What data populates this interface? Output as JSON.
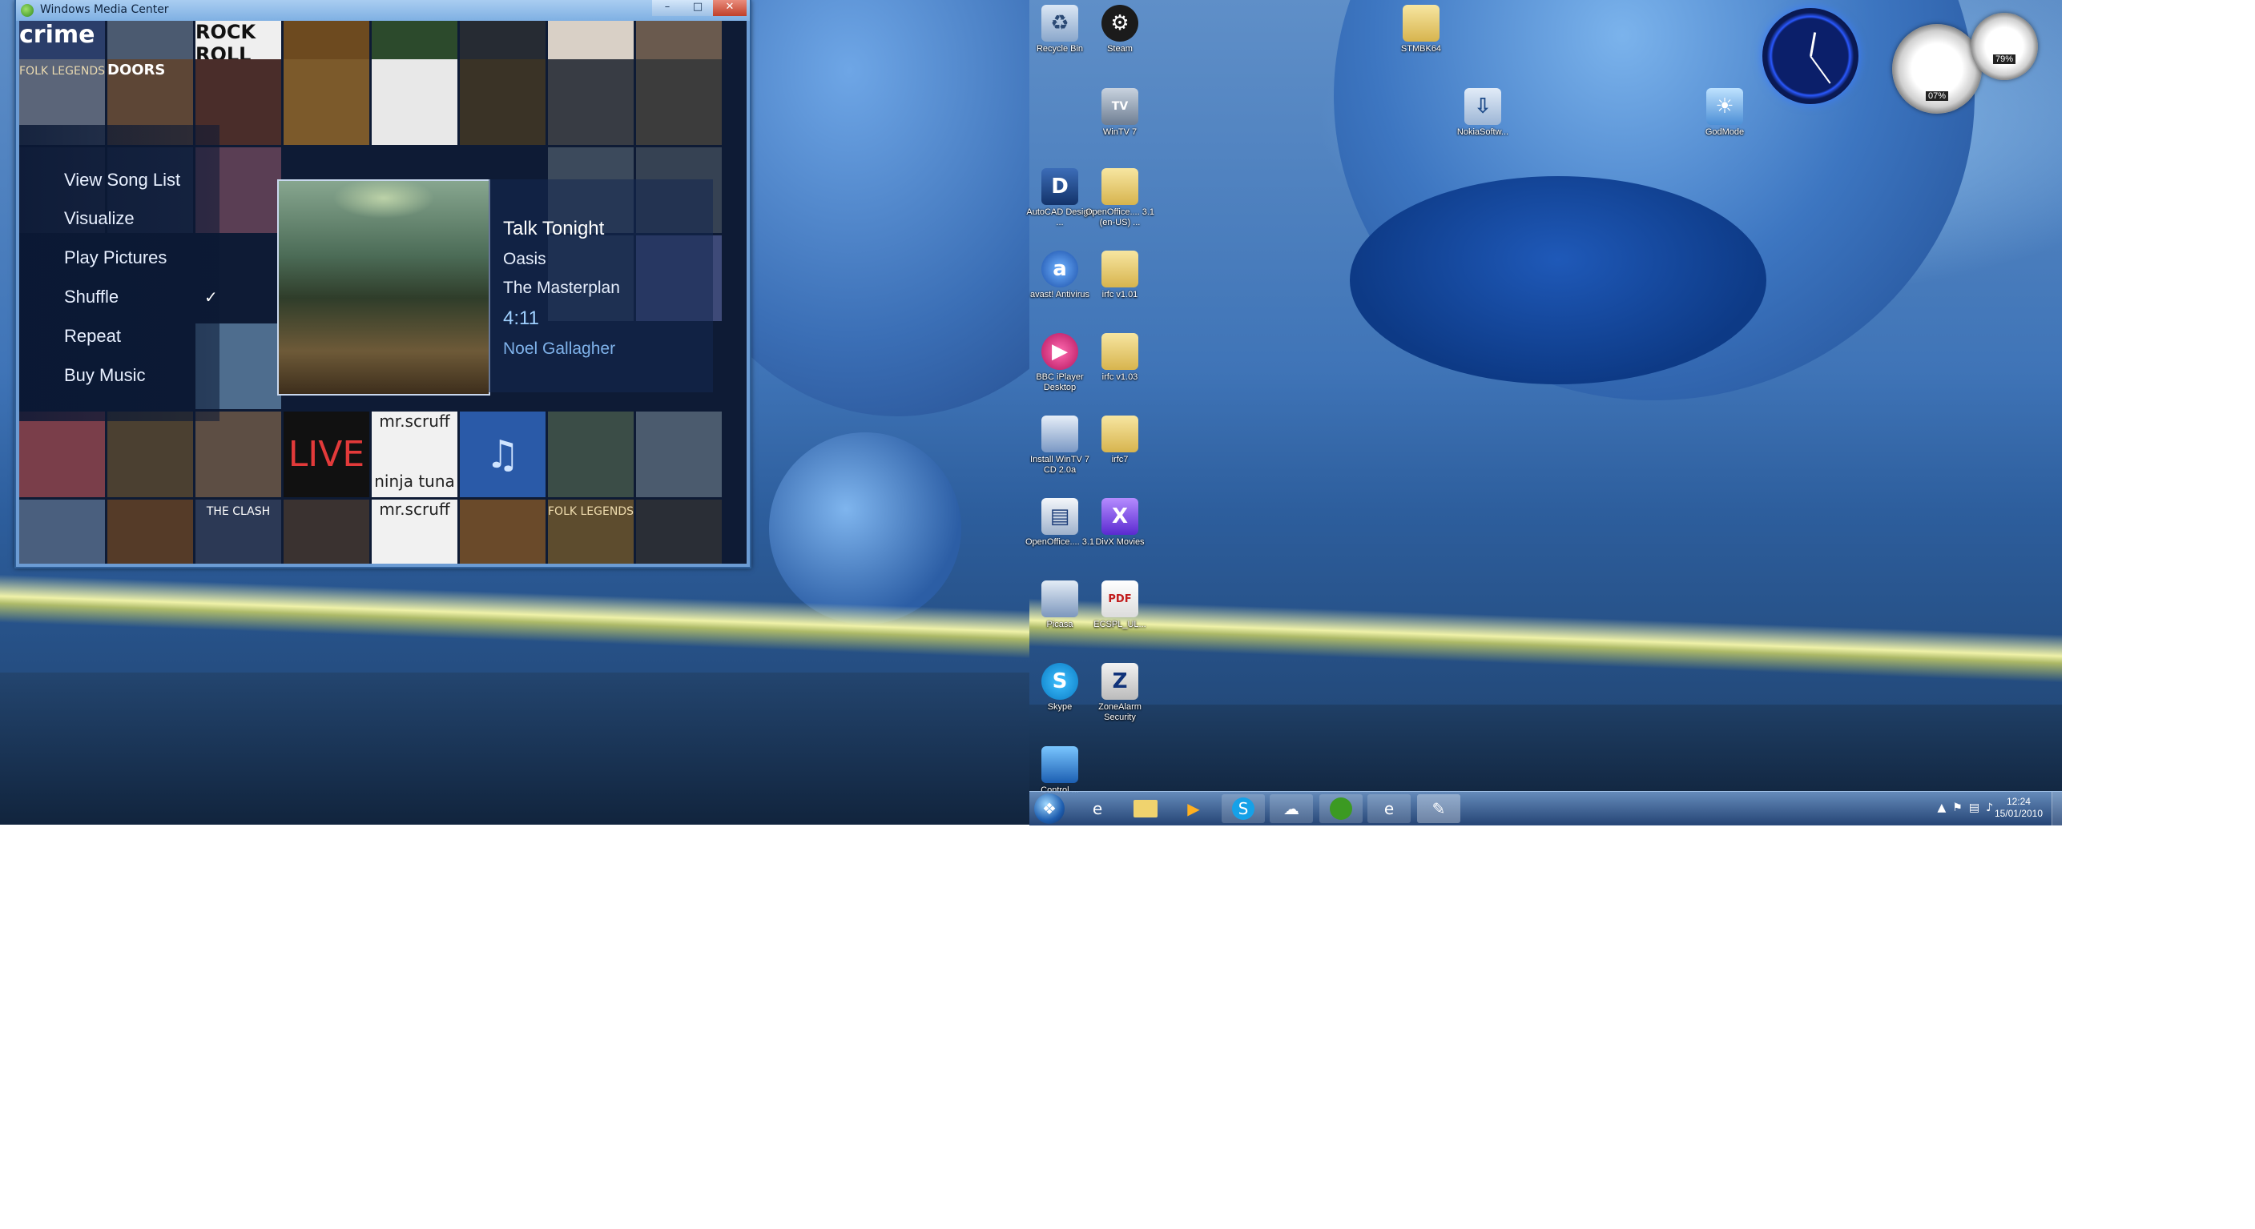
{
  "wmc": {
    "title": "Windows Media Center",
    "menu": [
      {
        "label": "View Song List"
      },
      {
        "label": "Visualize"
      },
      {
        "label": "Play Pictures"
      },
      {
        "label": "Shuffle",
        "checked": true
      },
      {
        "label": "Repeat"
      },
      {
        "label": "Buy Music"
      }
    ],
    "now_playing": {
      "song": "Talk Tonight",
      "artist": "Oasis",
      "album": "The Masterplan",
      "duration": "4:11",
      "composer": "Noel Gallagher"
    },
    "cover_texts": {
      "crime": "crime",
      "rock_roll": "ROCK ROLL",
      "folk_legends": "FOLK LEGENDS",
      "doors": "DOORS",
      "live": "LIVE",
      "mrscruff": "mr.scruff",
      "ninja_tuna": "ninja tuna",
      "clash": "THE CLASH"
    }
  },
  "desktop_icons": [
    {
      "label": "Recycle Bin",
      "icon": "recycle-bin-icon"
    },
    {
      "label": "Steam",
      "icon": "steam-icon"
    },
    {
      "label": "STMBK64",
      "icon": "folder-icon"
    },
    {
      "label": "WinTV 7",
      "icon": "wintv-icon"
    },
    {
      "label": "NokiaSoftw...",
      "icon": "download-icon"
    },
    {
      "label": "GodMode",
      "icon": "control-panel-icon"
    },
    {
      "label": "AutoCAD Design ...",
      "icon": "autocad-icon"
    },
    {
      "label": "OpenOffice.... 3.1 (en-US) ...",
      "icon": "folder-icon"
    },
    {
      "label": "avast! Antivirus",
      "icon": "avast-icon"
    },
    {
      "label": "irfc v1.01",
      "icon": "folder-icon"
    },
    {
      "label": "BBC iPlayer Desktop",
      "icon": "iplayer-icon"
    },
    {
      "label": "irfc v1.03",
      "icon": "folder-icon"
    },
    {
      "label": "Install WinTV 7 CD 2.0a",
      "icon": "installer-icon"
    },
    {
      "label": "irfc7",
      "icon": "folder-icon"
    },
    {
      "label": "OpenOffice.... 3.1",
      "icon": "openoffice-icon"
    },
    {
      "label": "DivX Movies",
      "icon": "divx-icon"
    },
    {
      "label": "Picasa",
      "icon": "picasa-icon"
    },
    {
      "label": "ECSPL_UL...",
      "icon": "pdf-icon"
    },
    {
      "label": "Skype",
      "icon": "skype-icon"
    },
    {
      "label": "ZoneAlarm Security",
      "icon": "zonealarm-icon"
    },
    {
      "label": "Control ...",
      "icon": "program-icon"
    }
  ],
  "gadgets": {
    "cpu_meter": {
      "cpu_percent": "07%",
      "ram_percent": "79%"
    }
  },
  "taskbar": {
    "buttons": [
      {
        "name": "internet-explorer"
      },
      {
        "name": "windows-explorer"
      },
      {
        "name": "media-player"
      },
      {
        "name": "skype"
      },
      {
        "name": "network"
      },
      {
        "name": "media-center"
      },
      {
        "name": "internet-explorer-2"
      },
      {
        "name": "paint"
      }
    ],
    "time": "12:24",
    "date": "15/01/2010"
  }
}
